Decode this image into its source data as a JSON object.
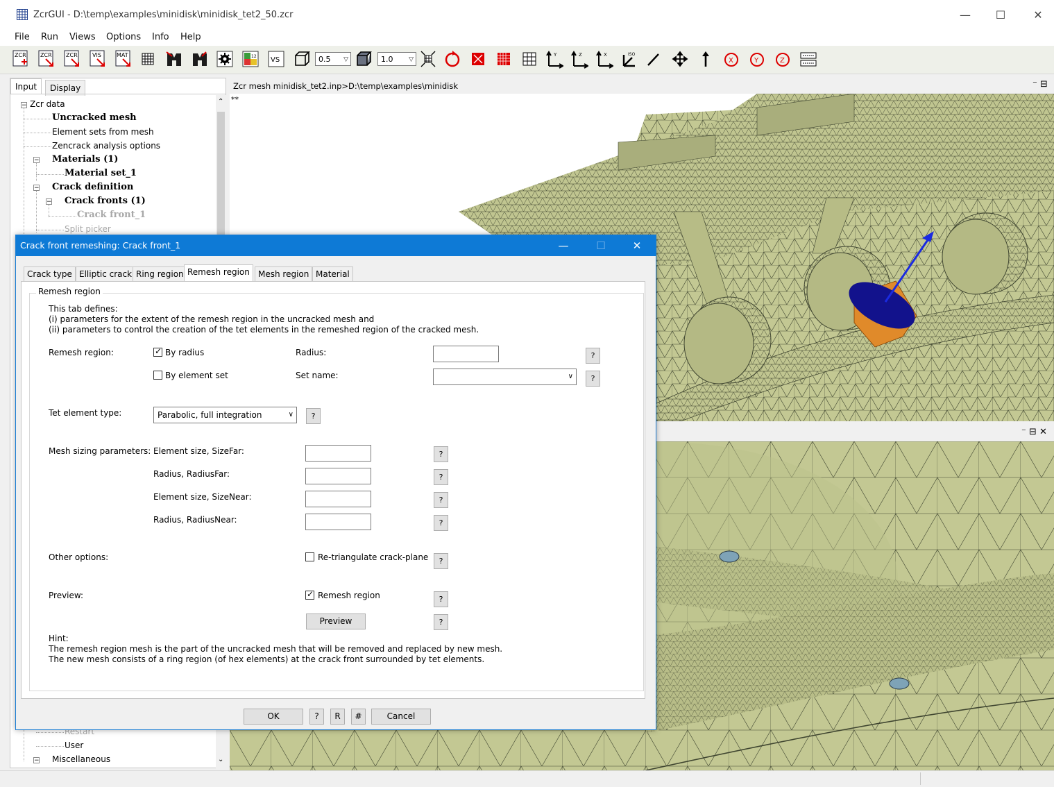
{
  "window": {
    "title": "ZcrGUI - D:\\temp\\examples\\minidisk\\minidisk_tet2_50.zcr",
    "minimize": "—",
    "maximize": "☐",
    "close": "✕"
  },
  "menu": [
    "File",
    "Run",
    "Views",
    "Options",
    "Info",
    "Help"
  ],
  "toolbar": {
    "combo1": "0.5",
    "combo2": "1.0",
    "icons": [
      "zcr-new-icon",
      "zcr-open-icon",
      "zcr-save-icon",
      "vis-icon",
      "mat-icon",
      "mesh-grid-icon",
      "mesh-a-icon",
      "mesh-b-icon",
      "settings-gear-icon",
      "colormap-icon",
      "vs-icon",
      "wireframe-cube-icon",
      "solid-cube-icon",
      "reset-view-icon",
      "rotate-icon",
      "red-square-icon",
      "red-mesh-icon",
      "grid-icon",
      "axis-yx-icon",
      "axis-zy-icon",
      "axis-xz-icon",
      "iso-view-icon",
      "line-icon",
      "pan-icon",
      "arrow-up-icon",
      "rotate-x-icon",
      "rotate-y-icon",
      "rotate-z-icon",
      "keyboard-icon"
    ]
  },
  "leftpanel": {
    "tabs": [
      "Input",
      "Display"
    ],
    "tree": [
      "Zcr data",
      "Uncracked mesh",
      "Element sets from mesh",
      "Zencrack analysis options",
      "Materials (1)",
      "Material set_1",
      "Crack definition",
      "Crack fronts (1)",
      "Crack front_1",
      "Split picker",
      "Restart",
      "User",
      "Miscellaneous"
    ]
  },
  "viewport1": {
    "header": "Zcr mesh minidisk_tet2.inp>D:\\temp\\examples\\minidisk",
    "corner_text": "**",
    "controls": "⁻ ⊟"
  },
  "viewport2": {
    "controls": "⁻ ⊟ ✕"
  },
  "dialog": {
    "title": "Crack front remeshing: Crack front_1",
    "tabs": [
      "Crack type",
      "Elliptic crack",
      "Ring region",
      "Remesh region",
      "Mesh region",
      "Material"
    ],
    "group_title": "Remesh region",
    "intro": [
      "This tab defines:",
      "(i) parameters for the extent of the remesh region in the uncracked mesh and",
      "(ii) parameters to control the creation of the tet elements in the remeshed region of the cracked mesh."
    ],
    "remesh_region_label": "Remesh region:",
    "by_radius": "By radius",
    "by_element_set": "By element set",
    "radius_label": "Radius:",
    "set_name_label": "Set name:",
    "tet_type_label": "Tet element type:",
    "tet_type_value": "Parabolic, full integration",
    "mesh_sizing_label": "Mesh sizing parameters:",
    "size_far": "Element size, SizeFar:",
    "radius_far": "Radius, RadiusFar:",
    "size_near": "Element size, SizeNear:",
    "radius_near": "Radius, RadiusNear:",
    "other_options_label": "Other options:",
    "retriangulate": "Re-triangulate crack-plane",
    "preview_label": "Preview:",
    "remesh_region_chk": "Remesh region",
    "preview_button": "Preview",
    "hint": [
      "Hint:",
      "The remesh region mesh is the part of the uncracked mesh that will be removed and replaced by new mesh.",
      "The new mesh consists of a ring region (of hex elements) at the crack front surrounded by tet elements."
    ],
    "help": "?",
    "ok": "OK",
    "r": "R",
    "hash": "#",
    "cancel": "Cancel",
    "minimize": "—",
    "maximize": "☐",
    "close": "✕"
  },
  "colors": {
    "mesh_fill": "#c3c893",
    "mesh_line": "#3f4530",
    "accent_blue": "#0e7ad6",
    "crack_orange": "#e08a2a",
    "crack_navy": "#12128c"
  }
}
